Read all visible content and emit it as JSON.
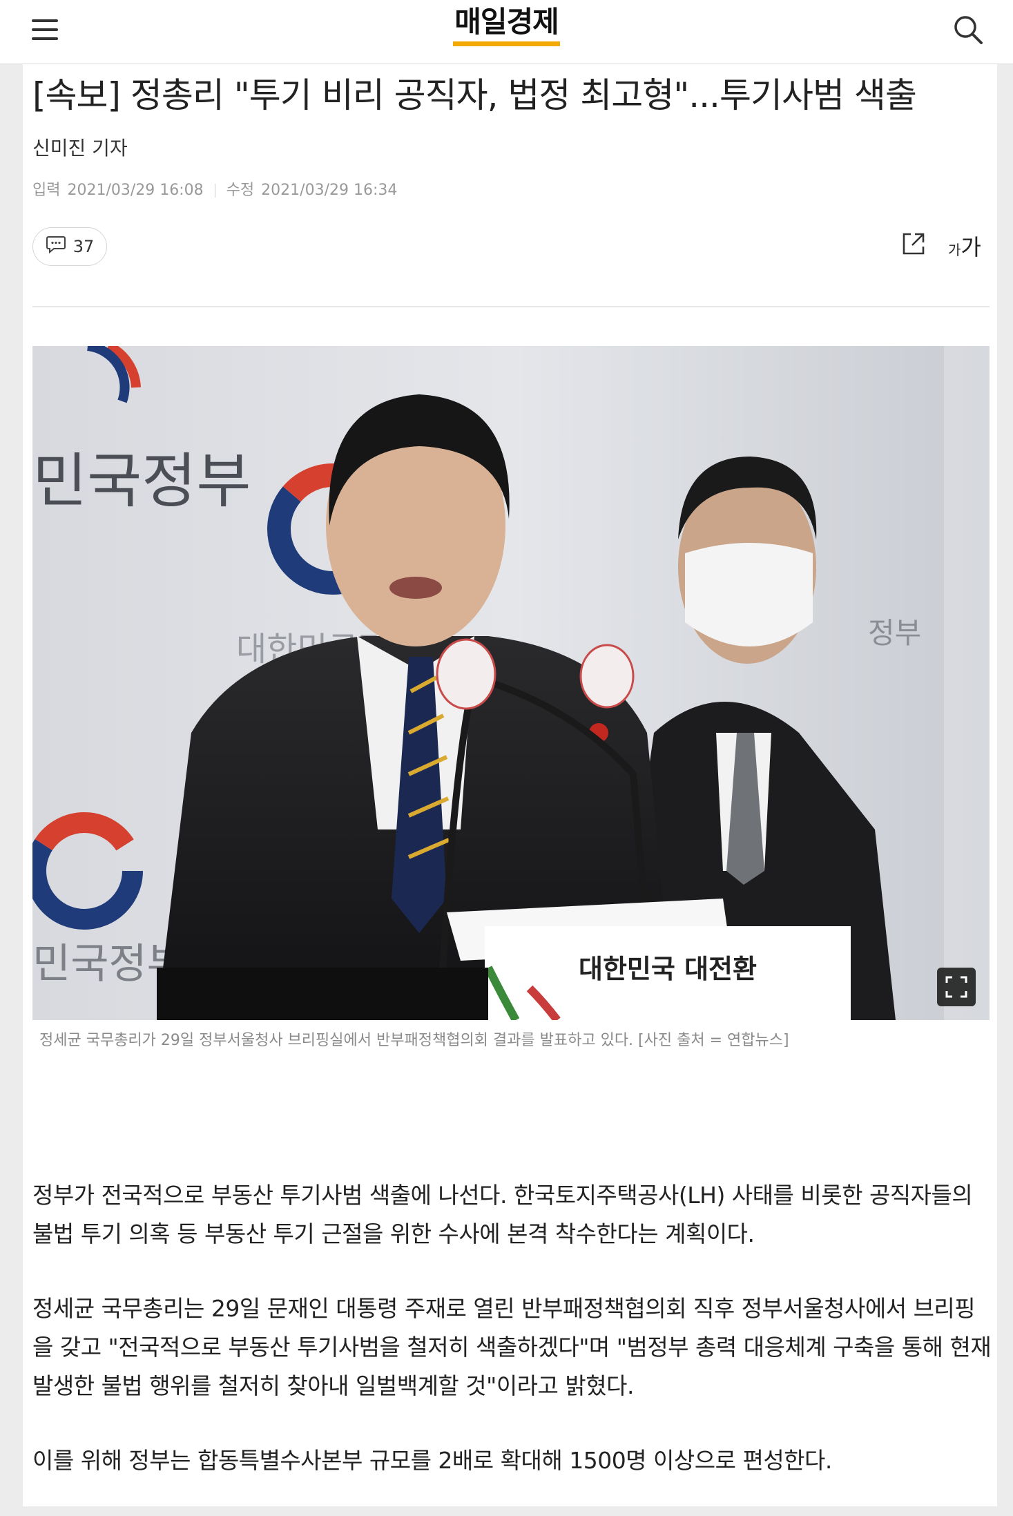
{
  "header": {
    "logo": "매일경제",
    "menu_icon": "hamburger-menu-icon",
    "search_icon": "search-icon"
  },
  "article": {
    "title": "[속보] 정총리 \"투기 비리 공직자, 법정 최고형\"...투기사범 색출",
    "reporter": "신미진 기자",
    "input_label": "입력",
    "input_date": "2021/03/29 16:08",
    "modified_label": "수정",
    "modified_date": "2021/03/29 16:34",
    "comment_count": "37",
    "font_size_small": "가",
    "font_size_large": "가"
  },
  "photo": {
    "backdrop_text_1": "민국정부",
    "backdrop_text_2": "대한민국정",
    "backdrop_text_3": "민국정부",
    "backdrop_text_4": "정부",
    "podium_text": "대한민국 대전환",
    "caption": "정세균 국무총리가 29일 정부서울청사 브리핑실에서 반부패정책협의회 결과를 발표하고 있다. [사진 출처 = 연합뉴스]"
  },
  "body": {
    "paragraphs": [
      "정부가 전국적으로 부동산 투기사범 색출에 나선다. 한국토지주택공사(LH) 사태를 비롯한 공직자들의 불법 투기 의혹 등 부동산 투기 근절을 위한 수사에 본격 착수한다는 계획이다.",
      "정세균 국무총리는 29일 문재인 대통령 주재로 열린 반부패정책협의회 직후 정부서울청사에서 브리핑을 갖고 \"전국적으로 부동산 투기사범을 철저히 색출하겠다\"며 \"범정부 총력 대응체계 구축을 통해 현재 발생한 불법 행위를 철저히 찾아내 일벌백계할 것\"이라고 밝혔다.",
      "이를 위해 정부는 합동특별수사본부 규모를 2배로 확대해 1500명 이상으로 편성한다."
    ]
  },
  "colors": {
    "logo_underline": "#f2a900",
    "caption_text": "#8a8a8a",
    "body_text": "#222222"
  }
}
